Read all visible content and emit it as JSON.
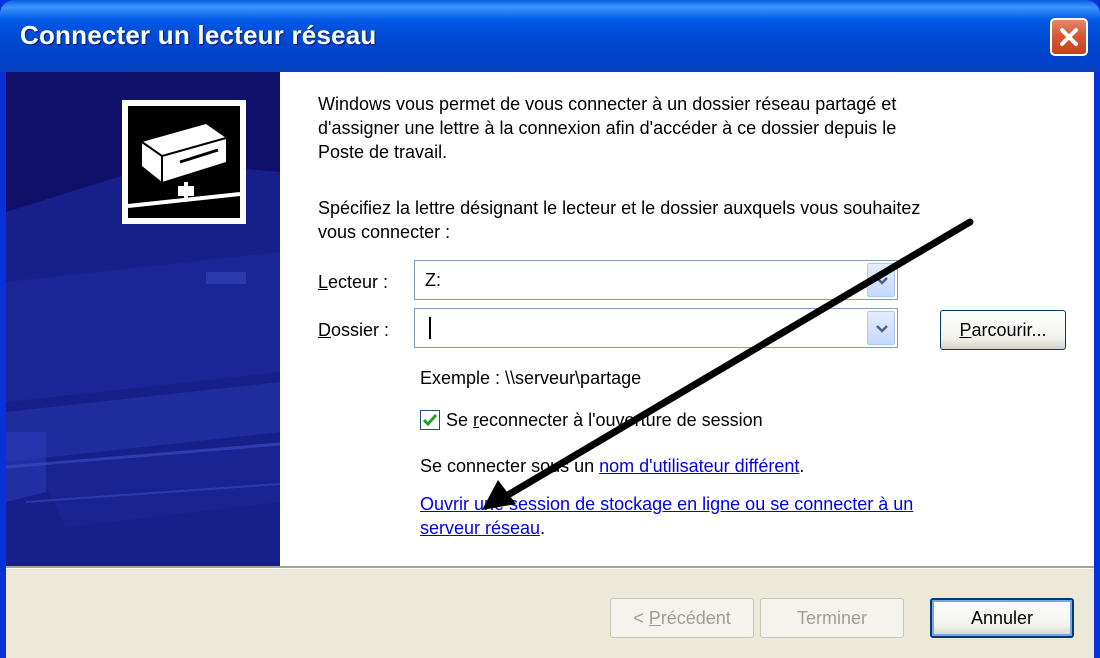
{
  "window": {
    "title": "Connecter un lecteur réseau",
    "close_icon": "close-icon"
  },
  "sidebar": {
    "icon": "network-drive-icon"
  },
  "content": {
    "intro_line1": "Windows vous permet de vous connecter à un dossier réseau partagé et",
    "intro_line2": "d'assigner une lettre à la connexion afin d'accéder à ce dossier depuis le",
    "intro_line3": "Poste de travail.",
    "instr_line1": "Spécifiez la lettre désignant le lecteur et le dossier auxquels vous souhaitez",
    "instr_line2": "vous connecter :"
  },
  "form": {
    "drive_label_mnemonic": "L",
    "drive_label_rest": "ecteur :",
    "drive_value": "Z:",
    "folder_label_mnemonic": "D",
    "folder_label_rest": "ossier :",
    "folder_value": "",
    "browse_mnemonic": "P",
    "browse_rest": "arcourir...",
    "example": "Exemple : \\\\serveur\\partage",
    "reconnect_before": "Se ",
    "reconnect_mnemonic": "r",
    "reconnect_after": "econnecter à l'ouverture de session",
    "reconnect_checked": true,
    "other_user_prefix": "Se connecter sous un ",
    "other_user_link": "nom d'utilisateur différent",
    "other_user_suffix": ".",
    "storage_link_line1": "Ouvrir une session de stockage en ligne ou se connecter à un",
    "storage_link_line2": "serveur réseau",
    "storage_suffix": "."
  },
  "buttons": {
    "back_prefix": "< ",
    "back_mnemonic": "P",
    "back_rest": "récédent",
    "finish": "Terminer",
    "cancel": "Annuler"
  },
  "colors": {
    "titlebar": "#0058e6",
    "link": "#0000ee",
    "sidebar": "#10106a",
    "dialog_bg": "#ece9d8"
  }
}
